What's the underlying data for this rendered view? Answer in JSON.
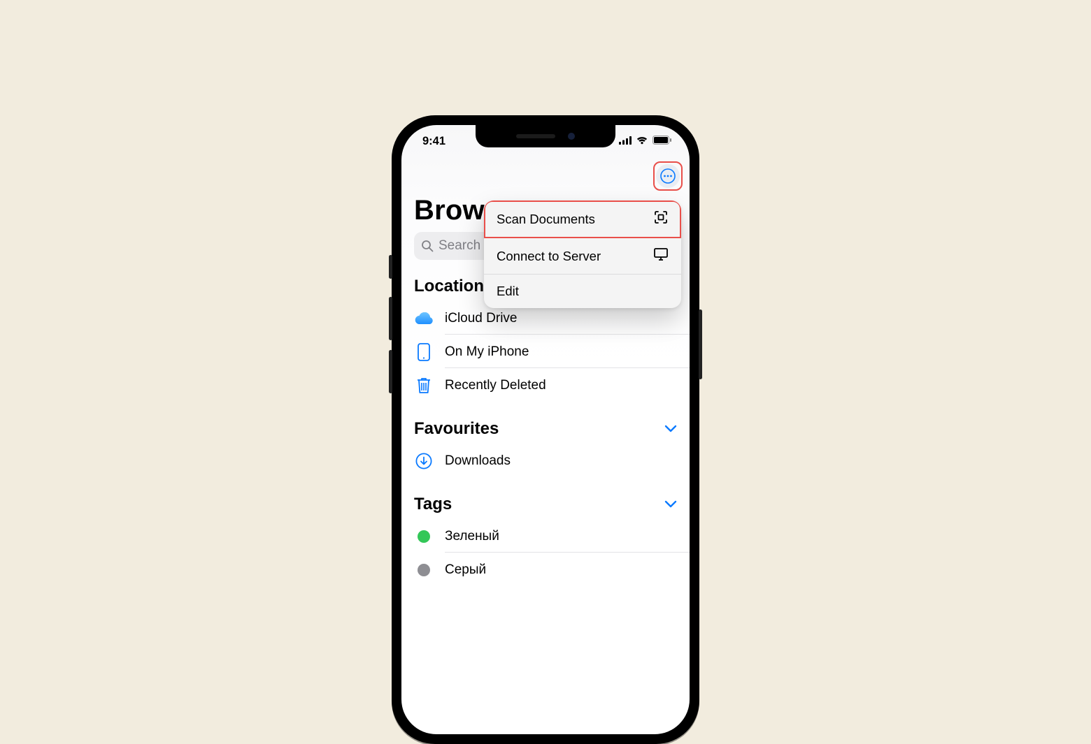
{
  "status": {
    "time": "9:41"
  },
  "page": {
    "title": "Browse"
  },
  "search": {
    "placeholder": "Search"
  },
  "menu": {
    "items": [
      {
        "label": "Scan Documents",
        "icon": "scan-icon",
        "highlight": true
      },
      {
        "label": "Connect to Server",
        "icon": "monitor-icon"
      },
      {
        "label": "Edit",
        "icon": ""
      }
    ]
  },
  "sections": {
    "locations": {
      "title": "Locations",
      "items": [
        {
          "label": "iCloud Drive"
        },
        {
          "label": "On My iPhone"
        },
        {
          "label": "Recently Deleted"
        }
      ]
    },
    "favourites": {
      "title": "Favourites",
      "items": [
        {
          "label": "Downloads"
        }
      ]
    },
    "tags": {
      "title": "Tags",
      "items": [
        {
          "label": "Зеленый",
          "color": "#33c758"
        },
        {
          "label": "Серый",
          "color": "#8e8e93"
        }
      ]
    }
  }
}
